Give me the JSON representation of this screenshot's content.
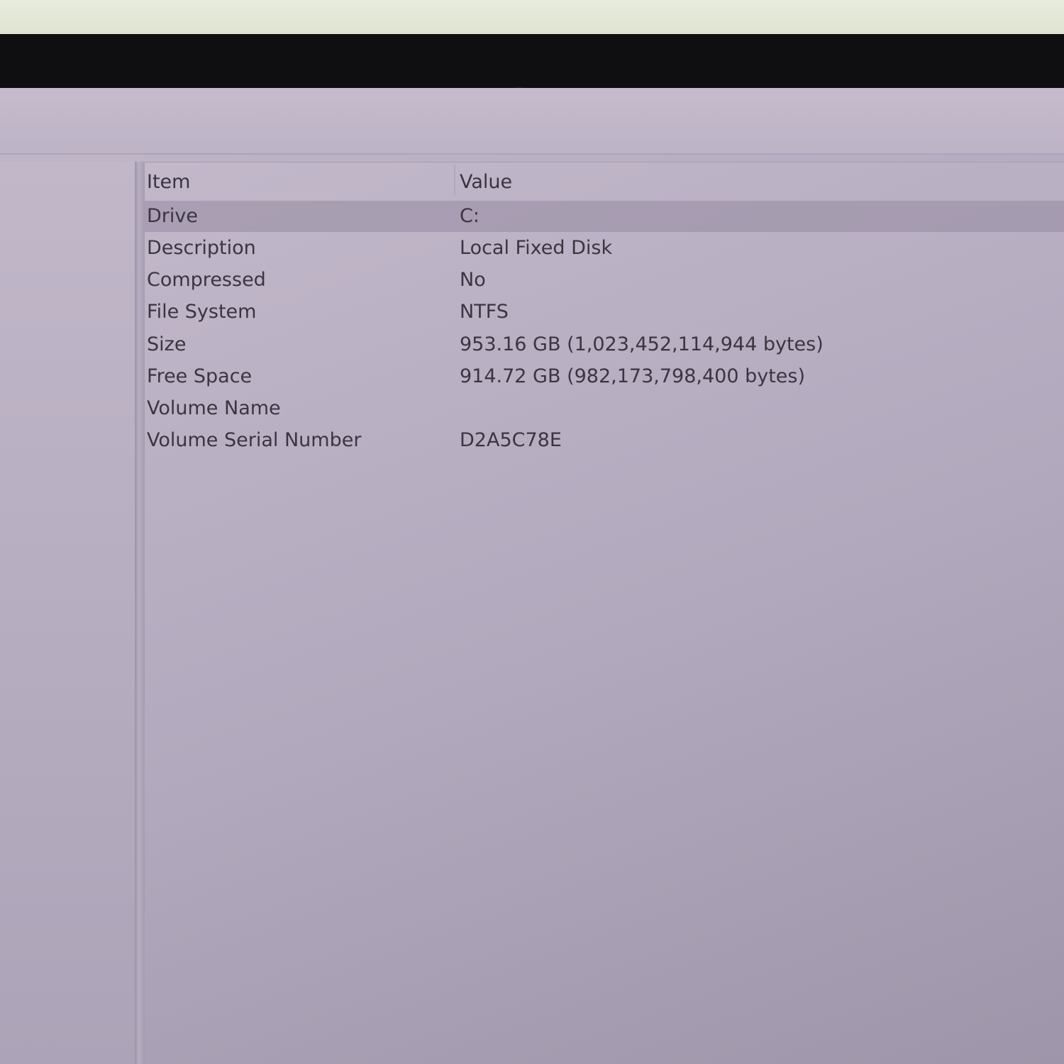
{
  "list": {
    "columns": {
      "item": "Item",
      "value": "Value"
    },
    "rows": [
      {
        "item": "Drive",
        "value": "C:",
        "selected": true
      },
      {
        "item": "Description",
        "value": "Local Fixed Disk"
      },
      {
        "item": "Compressed",
        "value": "No"
      },
      {
        "item": "File System",
        "value": "NTFS"
      },
      {
        "item": "Size",
        "value": "953.16 GB (1,023,452,114,944 bytes)"
      },
      {
        "item": "Free Space",
        "value": "914.72 GB (982,173,798,400 bytes)"
      },
      {
        "item": "Volume Name",
        "value": ""
      },
      {
        "item": "Volume Serial Number",
        "value": "D2A5C78E"
      }
    ]
  }
}
